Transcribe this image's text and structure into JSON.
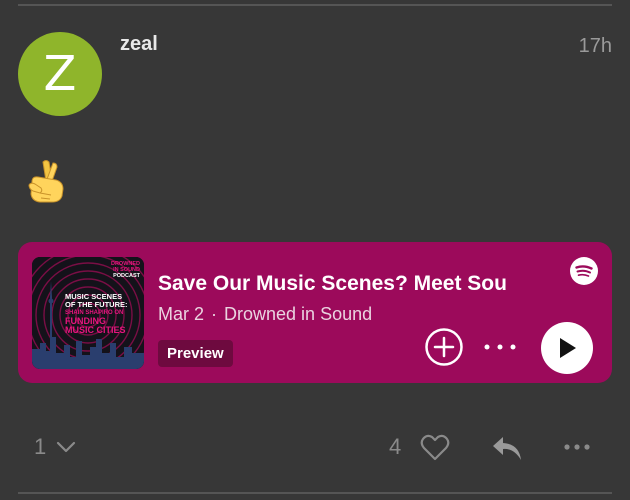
{
  "post": {
    "avatar_letter": "Z",
    "avatar_color": "#8fb52b",
    "username": "zeal",
    "timestamp": "17h",
    "emoji": "crossed-fingers-icon"
  },
  "embed": {
    "background": "#9c0a5b",
    "cover": {
      "line1": "DROWNED",
      "line2": "IN SOUND",
      "line3": "PODCAST",
      "heading": [
        "MUSIC SCENES",
        "OF THE FUTURE:"
      ],
      "subheading": [
        "SHAIN SHAPIRO ON"
      ],
      "highlight": [
        "FUNDING",
        "MUSIC CITIES"
      ]
    },
    "title": "Save Our Music Scenes? Meet Sou",
    "date": "Mar 2",
    "separator": "·",
    "show": "Drowned in Sound",
    "badge": "Preview",
    "icons": [
      "spotify-icon",
      "add-circle-icon",
      "more-horizontal-icon",
      "play-icon"
    ]
  },
  "actions": {
    "reply_count": "1",
    "like_count": "4",
    "icons": [
      "chevron-down-icon",
      "heart-icon",
      "reply-icon",
      "more-horizontal-icon"
    ]
  }
}
